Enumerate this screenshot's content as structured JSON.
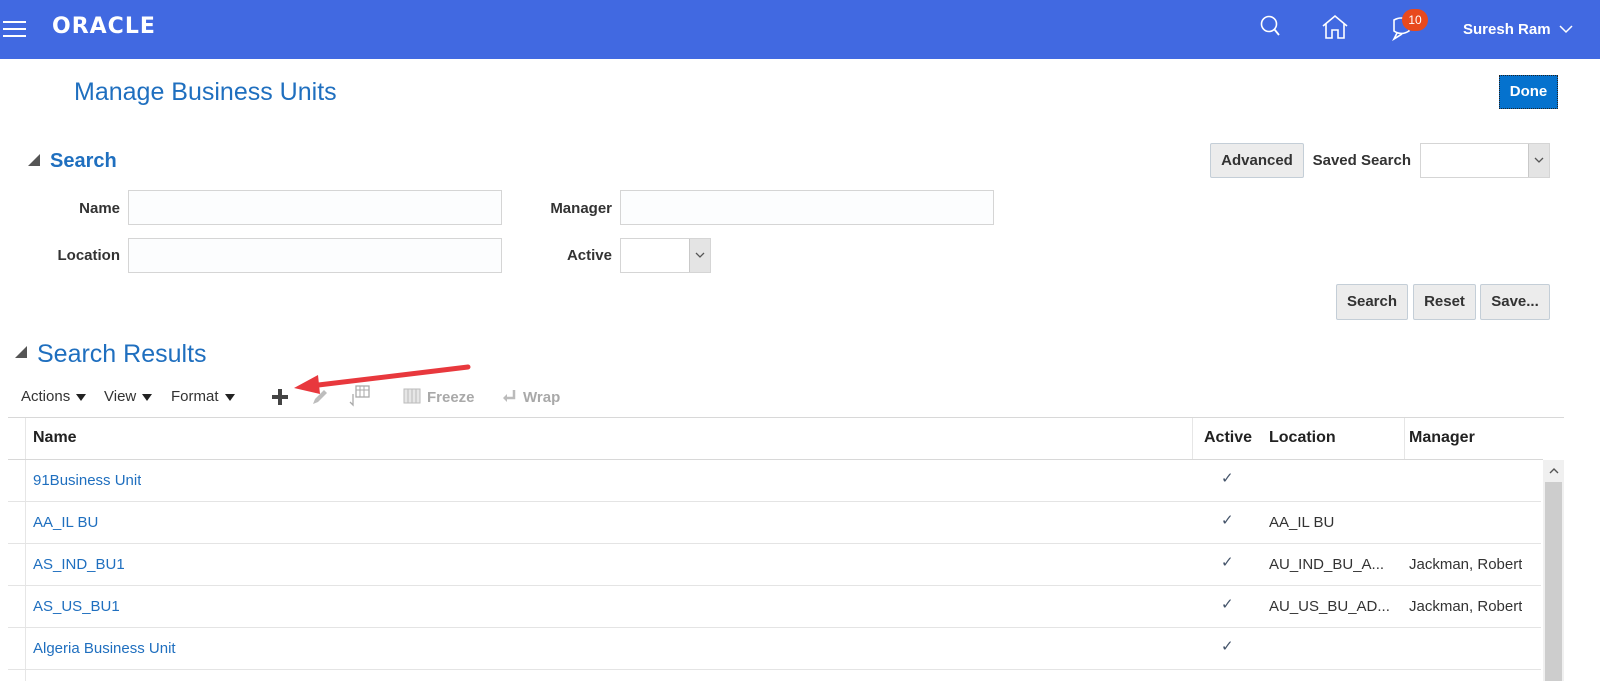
{
  "header": {
    "brand": "ORACLE",
    "notification_count": "10",
    "user_name": "Suresh Ram",
    "icons": [
      "menu-icon",
      "search-icon",
      "home-icon",
      "notifications-icon",
      "chevron-down-icon"
    ],
    "colors": {
      "bar": "#4169E1",
      "badge": "#e8491d"
    }
  },
  "page": {
    "title": "Manage Business Units",
    "done_label": "Done"
  },
  "search": {
    "section_title": "Search",
    "advanced_label": "Advanced",
    "saved_search_label": "Saved Search",
    "saved_search_value": "",
    "fields": {
      "name_label": "Name",
      "name_value": "",
      "manager_label": "Manager",
      "manager_value": "",
      "location_label": "Location",
      "location_value": "",
      "active_label": "Active",
      "active_value": ""
    },
    "buttons": {
      "search": "Search",
      "reset": "Reset",
      "save": "Save..."
    }
  },
  "results": {
    "section_title": "Search Results",
    "toolbar": {
      "actions": "Actions",
      "view": "View",
      "format": "Format",
      "freeze": "Freeze",
      "wrap": "Wrap",
      "icons": [
        "add-icon",
        "edit-icon",
        "column-settings-icon",
        "freeze-icon",
        "wrap-icon"
      ]
    },
    "columns": [
      "Name",
      "Active",
      "Location",
      "Manager"
    ],
    "rows": [
      {
        "name": "91Business Unit",
        "active": "✓",
        "location": "",
        "manager": ""
      },
      {
        "name": "AA_IL BU",
        "active": "✓",
        "location": "AA_IL BU",
        "manager": ""
      },
      {
        "name": "AS_IND_BU1",
        "active": "✓",
        "location": "AU_IND_BU_A...",
        "manager": "Jackman, Robert"
      },
      {
        "name": "AS_US_BU1",
        "active": "✓",
        "location": "AU_US_BU_AD...",
        "manager": "Jackman, Robert"
      },
      {
        "name": "Algeria Business Unit",
        "active": "✓",
        "location": "",
        "manager": ""
      }
    ]
  },
  "annotation": {
    "type": "red-arrow",
    "points_to": "add-icon",
    "color": "#e8383d"
  }
}
